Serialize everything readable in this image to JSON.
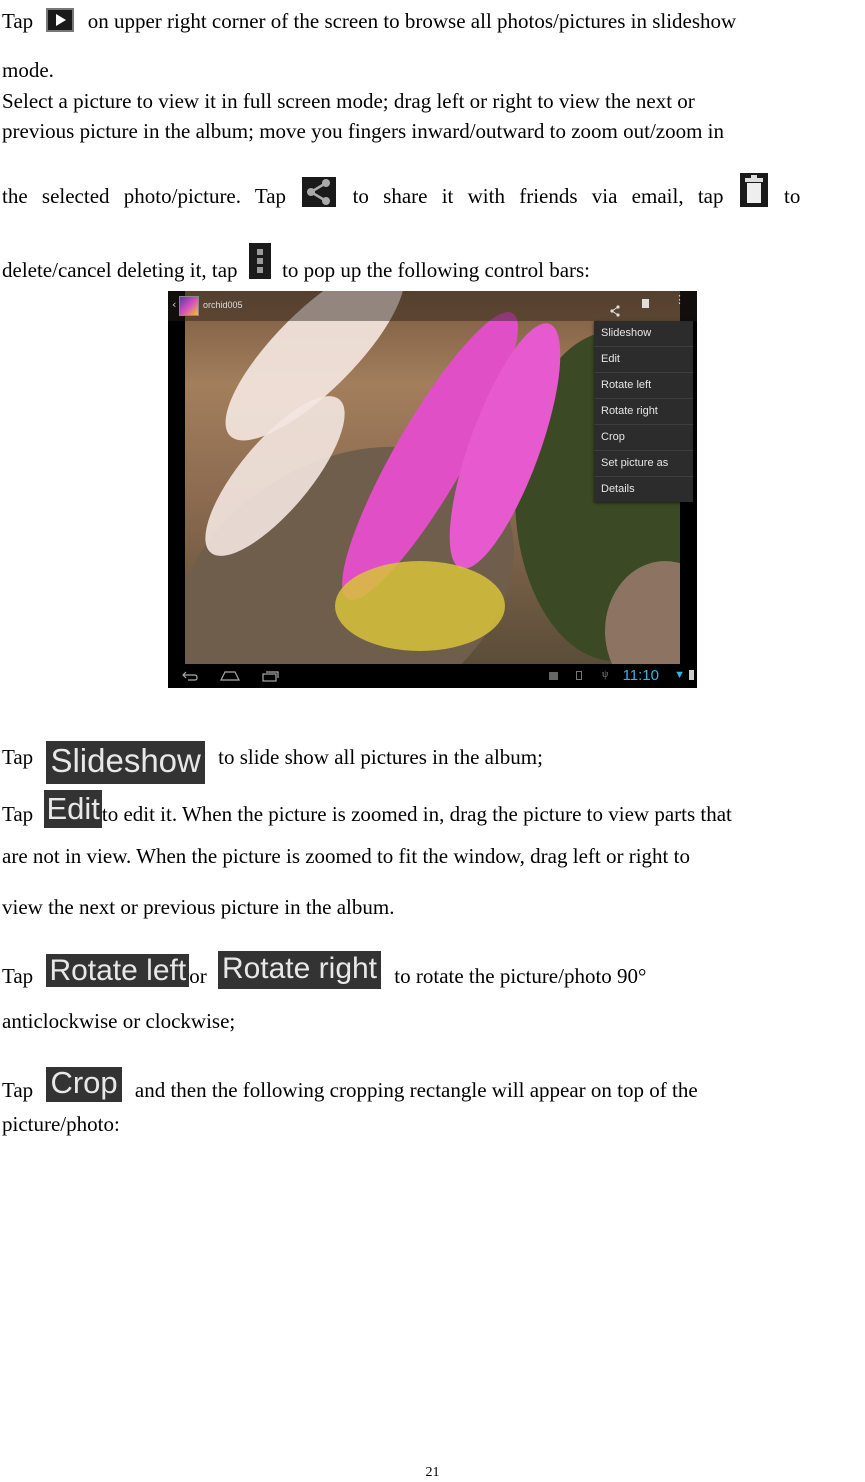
{
  "paragraphs": {
    "p1": {
      "before_icon": "Tap",
      "icon": "play-slideshow-icon",
      "after_icon": "on upper right corner of the screen to browse all photos/pictures in slideshow",
      "line2": "mode."
    },
    "p2": {
      "line1": "Select a picture to view it in full screen mode; drag left or right to view the next or",
      "line2": "previous picture in the album; move you fingers inward/outward to zoom out/zoom in",
      "line3_a": "the selected photo/picture. Tap",
      "line3_icon1": "share-icon",
      "line3_b": "to share it with friends via email, tap",
      "line3_icon2": "trash-icon",
      "line3_c": "to",
      "line4_a": "delete/cancel deleting it, tap",
      "line4_icon": "overflow-menu-icon",
      "line4_b": "to pop up the following control bars:"
    },
    "slideshow": {
      "tap": "Tap",
      "button": "Slideshow",
      "text": "to slide show all pictures in the album;"
    },
    "edit": {
      "tap": "Tap",
      "button": "Edit",
      "line1": "to edit it. When the picture is zoomed in, drag the picture to view parts that",
      "line2": "are not in view. When the picture is zoomed to fit the window, drag left or right to",
      "line3": "view the next or previous picture in the album."
    },
    "rotate": {
      "tap": "Tap",
      "button_left": "Rotate left",
      "or": "or",
      "button_right": "Rotate right",
      "line1": "to rotate the picture/photo 90°",
      "line2": "anticlockwise or clockwise;"
    },
    "crop": {
      "tap": "Tap",
      "button": "Crop",
      "line1": "and then the following cropping rectangle will appear on top of the",
      "line2": "picture/photo:"
    }
  },
  "screenshot": {
    "album_title": "orchid005",
    "menu_items": [
      "Slideshow",
      "Edit",
      "Rotate left",
      "Rotate right",
      "Crop",
      "Set picture as",
      "Details"
    ],
    "clock": "11:10",
    "accent_color": "#33b5e5"
  },
  "page_number": "21"
}
